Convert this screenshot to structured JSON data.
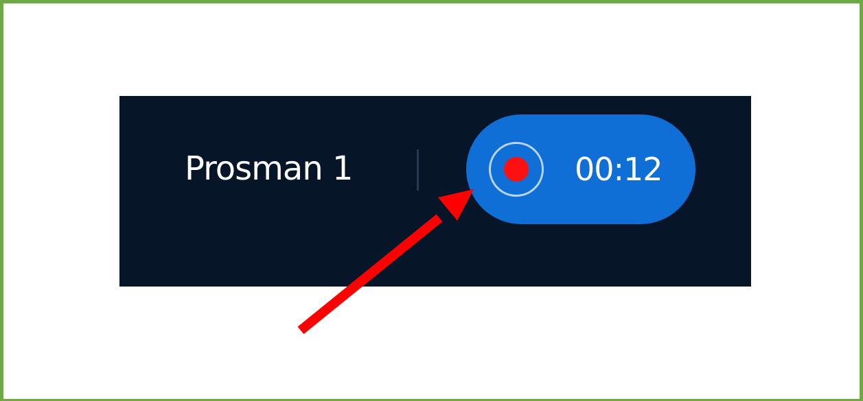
{
  "user": {
    "name": "Prosman 1"
  },
  "recording": {
    "timer": "00:12",
    "icon": "record-icon"
  },
  "colors": {
    "frame_border": "#70a845",
    "panel_background": "#061528",
    "pill_background": "#0f6fd6",
    "record_dot": "#ff1010",
    "arrow": "#ff0000"
  }
}
